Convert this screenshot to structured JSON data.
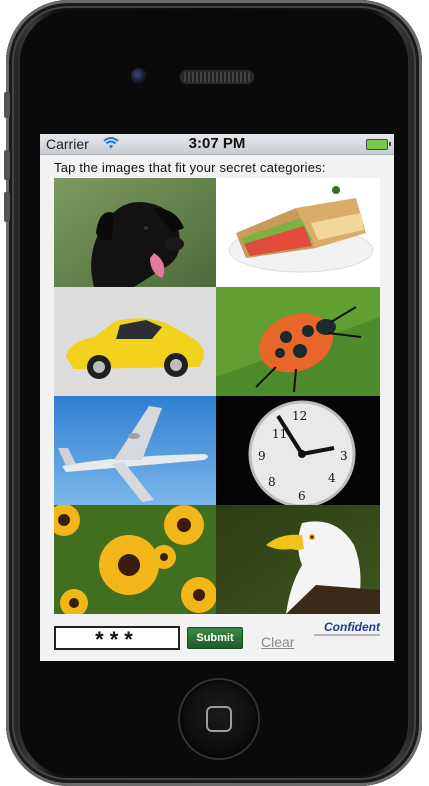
{
  "status_bar": {
    "carrier": "Carrier",
    "time": "3:07 PM",
    "wifi_icon": "wifi-icon",
    "battery_icon": "battery-icon"
  },
  "prompt": "Tap the images that fit your secret categories:",
  "tiles": [
    {
      "subject": "dog",
      "icon": "dog-image"
    },
    {
      "subject": "sandwich",
      "icon": "sandwich-image"
    },
    {
      "subject": "car",
      "icon": "car-image"
    },
    {
      "subject": "beetle",
      "icon": "beetle-image"
    },
    {
      "subject": "airplane",
      "icon": "airplane-image"
    },
    {
      "subject": "clock",
      "icon": "clock-image"
    },
    {
      "subject": "flowers",
      "icon": "flowers-image"
    },
    {
      "subject": "eagle",
      "icon": "eagle-image"
    }
  ],
  "footer": {
    "password_value": "***",
    "submit_label": "Submit",
    "clear_label": "Clear",
    "brand": "Confident"
  },
  "colors": {
    "submit_green": "#2f7a3c",
    "brand_blue": "#1f3f8a",
    "battery_green": "#79c94b"
  }
}
